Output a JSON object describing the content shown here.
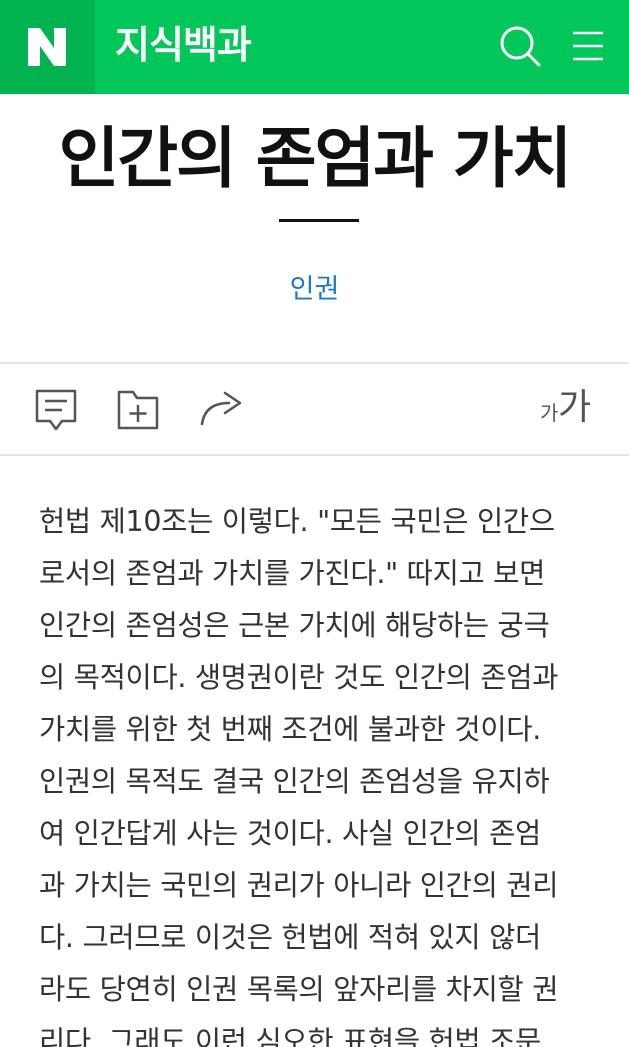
{
  "header": {
    "logo": "N",
    "app_title": "지식백과",
    "search_icon": "search-icon",
    "menu_icon": "menu-icon",
    "brand_color": "#03c75a"
  },
  "article": {
    "title": "인간의 존엄과 가치",
    "category": "인권",
    "category_color": "#1a7bc4"
  },
  "toolbar": {
    "icons": [
      "comment-icon",
      "folder-add-icon",
      "share-icon"
    ],
    "font_size_small": "가",
    "font_size_large": "가"
  },
  "body": {
    "lines": [
      "헌법 제10조는 이렇다. \"모든 국민은 인간으",
      "로서의 존엄과 가치를 가진다.\" 따지고 보면",
      "인간의 존엄성은 근본 가치에 해당하는 궁극",
      "의 목적이다. 생명권이란 것도 인간의 존엄과",
      "가치를 위한 첫 번째 조건에 불과한 것이다.",
      "인권의 목적도 결국 인간의 존엄성을 유지하",
      "여 인간답게 사는 것이다. 사실 인간의 존엄",
      "과 가치는 국민의 권리가 아니라 인간의 권리",
      "다. 그러므로 이것은 헌법에 적혀 있지 않더",
      "라도 당연히 인권 목록의 앞자리를 차지할 권",
      "리다. 그래도 이런 심오한 표현을 헌법 조문"
    ]
  }
}
